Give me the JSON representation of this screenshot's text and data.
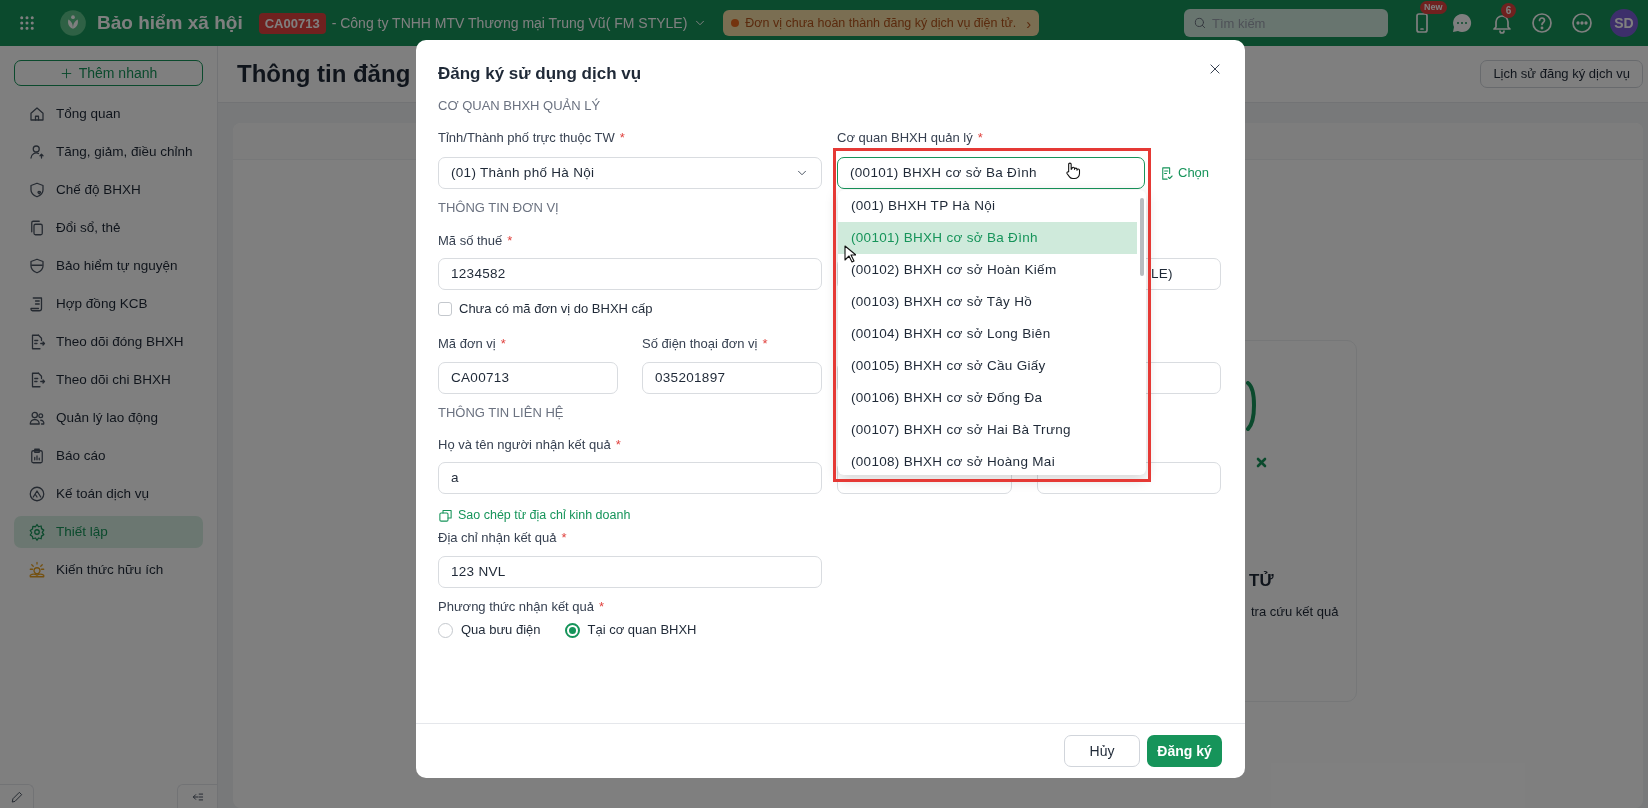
{
  "top_bar": {
    "app_name": "Bảo hiểm xã hội",
    "unit_code": "CA00713",
    "company": "- Công ty TNHH MTV Thương mại Trung Vũ( FM STYLE)",
    "notice": "Đơn vị chưa hoàn thành đăng ký dịch vụ điện tử.",
    "notice_arrow": "›",
    "search": {
      "placeholder": "Tìm kiếm"
    },
    "new_badge": "New",
    "notification_count": "6",
    "avatar": "SD"
  },
  "sidebar": {
    "quick_add": "Thêm nhanh",
    "items": [
      {
        "label": "Tổng quan",
        "selected": false
      },
      {
        "label": "Tăng, giảm, điều chỉnh",
        "selected": false
      },
      {
        "label": "Chế độ BHXH",
        "selected": false
      },
      {
        "label": "Đổi sổ, thẻ",
        "selected": false
      },
      {
        "label": "Bảo hiểm tự nguyện",
        "selected": false
      },
      {
        "label": "Hợp đồng KCB",
        "selected": false
      },
      {
        "label": "Theo dõi đóng BHXH",
        "selected": false
      },
      {
        "label": "Theo dõi chi BHXH",
        "selected": false
      },
      {
        "label": "Quản lý lao động",
        "selected": false
      },
      {
        "label": "Báo cáo",
        "selected": false
      },
      {
        "label": "Kế toán dịch vụ",
        "selected": false
      },
      {
        "label": "Thiết lập",
        "selected": true
      },
      {
        "label": "Kiến thức hữu ích",
        "selected": false
      }
    ]
  },
  "page": {
    "title": "Thông tin đăng",
    "history_button": "Lịch sử đăng ký dịch vụ",
    "card_heading": "TỬ",
    "card_text": "tra cứu kết quả"
  },
  "dialog": {
    "title": "Đăng ký sử dụng dịch vụ",
    "agency_section": "CƠ QUAN BHXH QUẢN LÝ",
    "province": {
      "label": "Tỉnh/Thành phố trực thuộc TW",
      "required": "*",
      "value": "(01) Thành phố Hà Nội"
    },
    "agency": {
      "label": "Cơ quan BHXH quản lý",
      "required": "*",
      "value": "(00101) BHXH cơ sở Ba Đình",
      "open": true
    },
    "choose_link": "Chọn",
    "unit_section": "THÔNG TIN ĐƠN VỊ",
    "tax_code": {
      "label": "Mã số thuế",
      "required": "*",
      "value": "1234582"
    },
    "unit_name": {
      "value": "LE)"
    },
    "no_unit_code": {
      "label": "Chưa có mã đơn vị do BHXH cấp",
      "checked": false
    },
    "unit_code": {
      "label": "Mã đơn vị",
      "required": "*",
      "value": "CA00713"
    },
    "unit_phone": {
      "label": "Số điện thoại đơn vị",
      "required": "*",
      "value": "035201897"
    },
    "contact_section": "THÔNG TIN LIÊN HỆ",
    "recipient": {
      "label": "Họ và tên người nhận kết quả",
      "required": "*",
      "value": "a"
    },
    "copy_link": "Sao chép từ địa chỉ kinh doanh",
    "address": {
      "label": "Địa chỉ nhận kết quả",
      "required": "*",
      "value": "123 NVL"
    },
    "delivery": {
      "label": "Phương thức nhận kết quả",
      "required": "*",
      "options": [
        {
          "label": "Qua bưu điện",
          "selected": false
        },
        {
          "label": "Tại cơ quan BHXH",
          "selected": true
        }
      ]
    },
    "cancel_button": "Hủy",
    "submit_button": "Đăng ký"
  },
  "dropdown": {
    "options": [
      {
        "label": "(001) BHXH TP Hà Nội",
        "selected": false
      },
      {
        "label": "(00101) BHXH cơ sở Ba Đình",
        "selected": true
      },
      {
        "label": "(00102) BHXH cơ sở Hoàn Kiếm",
        "selected": false
      },
      {
        "label": "(00103) BHXH cơ sở Tây Hồ",
        "selected": false
      },
      {
        "label": "(00104) BHXH cơ sở Long Biên",
        "selected": false
      },
      {
        "label": "(00105) BHXH cơ sở Cầu Giấy",
        "selected": false
      },
      {
        "label": "(00106) BHXH cơ sở Đống Đa",
        "selected": false
      },
      {
        "label": "(00107) BHXH cơ sở Hai Bà Trưng",
        "selected": false
      },
      {
        "label": "(00108) BHXH cơ sở Hoàng Mai",
        "selected": false
      }
    ]
  }
}
